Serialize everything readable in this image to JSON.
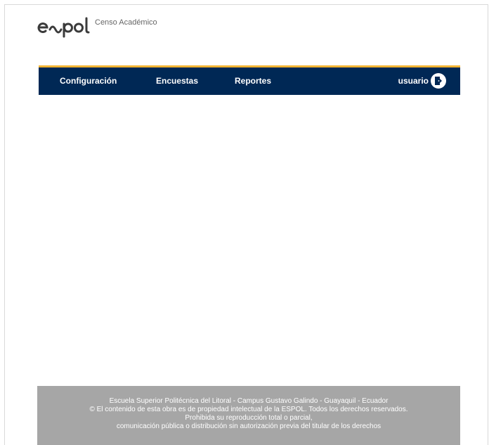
{
  "header": {
    "logo_text": "espol",
    "subtitle": "Censo Académico"
  },
  "nav": {
    "items": [
      {
        "label": "Configuración"
      },
      {
        "label": "Encuestas"
      },
      {
        "label": "Reportes"
      }
    ],
    "user": "usuario",
    "logout_icon": "logout-door-icon"
  },
  "footer": {
    "lines": [
      "Escuela Superior Politécnica del Litoral - Campus Gustavo Galindo - Guayaquil - Ecuador",
      "© El contenido de esta obra es de propiedad intelectual de la ESPOL. Todos los derechos reservados.",
      "Prohibida su reproducción total o parcial,",
      "comunicación pública o distribución sin autorización previa del titular de los derechos"
    ]
  },
  "colors": {
    "navbar": "#002855",
    "accent": "#f2b333",
    "footer": "#a6a6a6"
  }
}
